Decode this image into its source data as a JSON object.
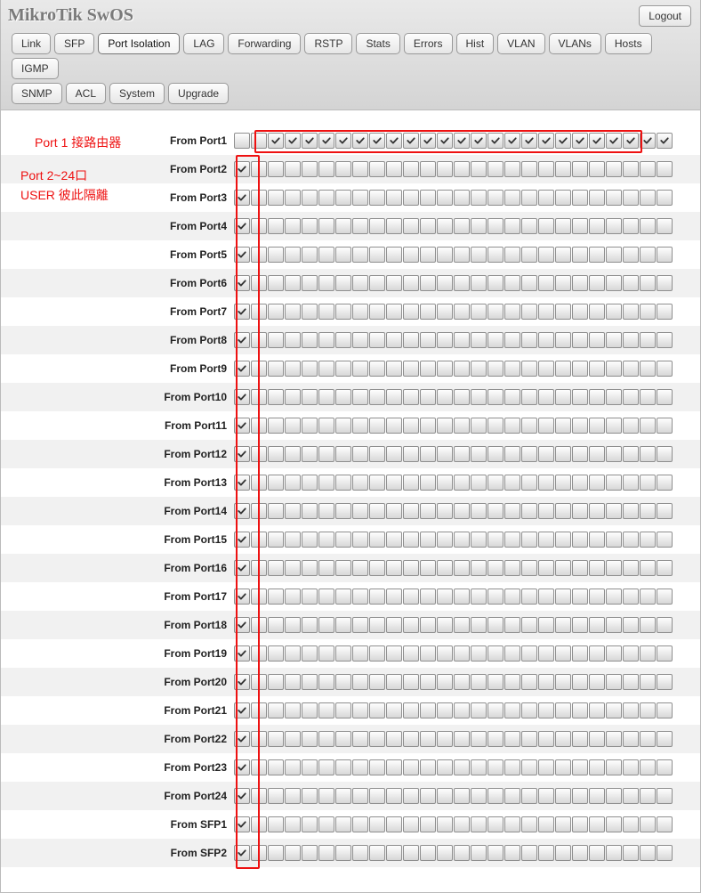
{
  "title": "MikroTik SwOS",
  "logout_label": "Logout",
  "tabs_row1": [
    "Link",
    "SFP",
    "Port Isolation",
    "LAG",
    "Forwarding",
    "RSTP",
    "Stats",
    "Errors",
    "Hist",
    "VLAN",
    "VLANs",
    "Hosts",
    "IGMP"
  ],
  "tabs_row2": [
    "SNMP",
    "ACL",
    "System",
    "Upgrade"
  ],
  "active_tab": "Port Isolation",
  "rows": [
    {
      "label": "From Port1",
      "checked": [
        0,
        0,
        1,
        1,
        1,
        1,
        1,
        1,
        1,
        1,
        1,
        1,
        1,
        1,
        1,
        1,
        1,
        1,
        1,
        1,
        1,
        1,
        1,
        1,
        1,
        1
      ]
    },
    {
      "label": "From Port2",
      "checked": [
        1,
        0,
        0,
        0,
        0,
        0,
        0,
        0,
        0,
        0,
        0,
        0,
        0,
        0,
        0,
        0,
        0,
        0,
        0,
        0,
        0,
        0,
        0,
        0,
        0,
        0
      ]
    },
    {
      "label": "From Port3",
      "checked": [
        1,
        0,
        0,
        0,
        0,
        0,
        0,
        0,
        0,
        0,
        0,
        0,
        0,
        0,
        0,
        0,
        0,
        0,
        0,
        0,
        0,
        0,
        0,
        0,
        0,
        0
      ]
    },
    {
      "label": "From Port4",
      "checked": [
        1,
        0,
        0,
        0,
        0,
        0,
        0,
        0,
        0,
        0,
        0,
        0,
        0,
        0,
        0,
        0,
        0,
        0,
        0,
        0,
        0,
        0,
        0,
        0,
        0,
        0
      ]
    },
    {
      "label": "From Port5",
      "checked": [
        1,
        0,
        0,
        0,
        0,
        0,
        0,
        0,
        0,
        0,
        0,
        0,
        0,
        0,
        0,
        0,
        0,
        0,
        0,
        0,
        0,
        0,
        0,
        0,
        0,
        0
      ]
    },
    {
      "label": "From Port6",
      "checked": [
        1,
        0,
        0,
        0,
        0,
        0,
        0,
        0,
        0,
        0,
        0,
        0,
        0,
        0,
        0,
        0,
        0,
        0,
        0,
        0,
        0,
        0,
        0,
        0,
        0,
        0
      ]
    },
    {
      "label": "From Port7",
      "checked": [
        1,
        0,
        0,
        0,
        0,
        0,
        0,
        0,
        0,
        0,
        0,
        0,
        0,
        0,
        0,
        0,
        0,
        0,
        0,
        0,
        0,
        0,
        0,
        0,
        0,
        0
      ]
    },
    {
      "label": "From Port8",
      "checked": [
        1,
        0,
        0,
        0,
        0,
        0,
        0,
        0,
        0,
        0,
        0,
        0,
        0,
        0,
        0,
        0,
        0,
        0,
        0,
        0,
        0,
        0,
        0,
        0,
        0,
        0
      ]
    },
    {
      "label": "From Port9",
      "checked": [
        1,
        0,
        0,
        0,
        0,
        0,
        0,
        0,
        0,
        0,
        0,
        0,
        0,
        0,
        0,
        0,
        0,
        0,
        0,
        0,
        0,
        0,
        0,
        0,
        0,
        0
      ]
    },
    {
      "label": "From Port10",
      "checked": [
        1,
        0,
        0,
        0,
        0,
        0,
        0,
        0,
        0,
        0,
        0,
        0,
        0,
        0,
        0,
        0,
        0,
        0,
        0,
        0,
        0,
        0,
        0,
        0,
        0,
        0
      ]
    },
    {
      "label": "From Port11",
      "checked": [
        1,
        0,
        0,
        0,
        0,
        0,
        0,
        0,
        0,
        0,
        0,
        0,
        0,
        0,
        0,
        0,
        0,
        0,
        0,
        0,
        0,
        0,
        0,
        0,
        0,
        0
      ]
    },
    {
      "label": "From Port12",
      "checked": [
        1,
        0,
        0,
        0,
        0,
        0,
        0,
        0,
        0,
        0,
        0,
        0,
        0,
        0,
        0,
        0,
        0,
        0,
        0,
        0,
        0,
        0,
        0,
        0,
        0,
        0
      ]
    },
    {
      "label": "From Port13",
      "checked": [
        1,
        0,
        0,
        0,
        0,
        0,
        0,
        0,
        0,
        0,
        0,
        0,
        0,
        0,
        0,
        0,
        0,
        0,
        0,
        0,
        0,
        0,
        0,
        0,
        0,
        0
      ]
    },
    {
      "label": "From Port14",
      "checked": [
        1,
        0,
        0,
        0,
        0,
        0,
        0,
        0,
        0,
        0,
        0,
        0,
        0,
        0,
        0,
        0,
        0,
        0,
        0,
        0,
        0,
        0,
        0,
        0,
        0,
        0
      ]
    },
    {
      "label": "From Port15",
      "checked": [
        1,
        0,
        0,
        0,
        0,
        0,
        0,
        0,
        0,
        0,
        0,
        0,
        0,
        0,
        0,
        0,
        0,
        0,
        0,
        0,
        0,
        0,
        0,
        0,
        0,
        0
      ]
    },
    {
      "label": "From Port16",
      "checked": [
        1,
        0,
        0,
        0,
        0,
        0,
        0,
        0,
        0,
        0,
        0,
        0,
        0,
        0,
        0,
        0,
        0,
        0,
        0,
        0,
        0,
        0,
        0,
        0,
        0,
        0
      ]
    },
    {
      "label": "From Port17",
      "checked": [
        1,
        0,
        0,
        0,
        0,
        0,
        0,
        0,
        0,
        0,
        0,
        0,
        0,
        0,
        0,
        0,
        0,
        0,
        0,
        0,
        0,
        0,
        0,
        0,
        0,
        0
      ]
    },
    {
      "label": "From Port18",
      "checked": [
        1,
        0,
        0,
        0,
        0,
        0,
        0,
        0,
        0,
        0,
        0,
        0,
        0,
        0,
        0,
        0,
        0,
        0,
        0,
        0,
        0,
        0,
        0,
        0,
        0,
        0
      ]
    },
    {
      "label": "From Port19",
      "checked": [
        1,
        0,
        0,
        0,
        0,
        0,
        0,
        0,
        0,
        0,
        0,
        0,
        0,
        0,
        0,
        0,
        0,
        0,
        0,
        0,
        0,
        0,
        0,
        0,
        0,
        0
      ]
    },
    {
      "label": "From Port20",
      "checked": [
        1,
        0,
        0,
        0,
        0,
        0,
        0,
        0,
        0,
        0,
        0,
        0,
        0,
        0,
        0,
        0,
        0,
        0,
        0,
        0,
        0,
        0,
        0,
        0,
        0,
        0
      ]
    },
    {
      "label": "From Port21",
      "checked": [
        1,
        0,
        0,
        0,
        0,
        0,
        0,
        0,
        0,
        0,
        0,
        0,
        0,
        0,
        0,
        0,
        0,
        0,
        0,
        0,
        0,
        0,
        0,
        0,
        0,
        0
      ]
    },
    {
      "label": "From Port22",
      "checked": [
        1,
        0,
        0,
        0,
        0,
        0,
        0,
        0,
        0,
        0,
        0,
        0,
        0,
        0,
        0,
        0,
        0,
        0,
        0,
        0,
        0,
        0,
        0,
        0,
        0,
        0
      ]
    },
    {
      "label": "From Port23",
      "checked": [
        1,
        0,
        0,
        0,
        0,
        0,
        0,
        0,
        0,
        0,
        0,
        0,
        0,
        0,
        0,
        0,
        0,
        0,
        0,
        0,
        0,
        0,
        0,
        0,
        0,
        0
      ]
    },
    {
      "label": "From Port24",
      "checked": [
        1,
        0,
        0,
        0,
        0,
        0,
        0,
        0,
        0,
        0,
        0,
        0,
        0,
        0,
        0,
        0,
        0,
        0,
        0,
        0,
        0,
        0,
        0,
        0,
        0,
        0
      ]
    },
    {
      "label": "From SFP1",
      "checked": [
        1,
        0,
        0,
        0,
        0,
        0,
        0,
        0,
        0,
        0,
        0,
        0,
        0,
        0,
        0,
        0,
        0,
        0,
        0,
        0,
        0,
        0,
        0,
        0,
        0,
        0
      ]
    },
    {
      "label": "From SFP2",
      "checked": [
        1,
        0,
        0,
        0,
        0,
        0,
        0,
        0,
        0,
        0,
        0,
        0,
        0,
        0,
        0,
        0,
        0,
        0,
        0,
        0,
        0,
        0,
        0,
        0,
        0,
        0
      ]
    }
  ],
  "annotations": {
    "caption1": "Port 1 接路由器",
    "caption2": "Port 2~24口\nUSER 彼此隔離"
  }
}
